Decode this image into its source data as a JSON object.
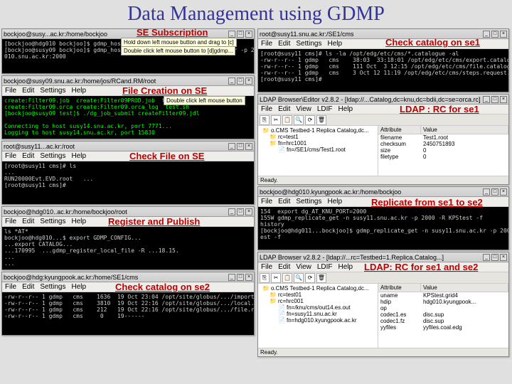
{
  "page_title": "Data Management using GDMP",
  "annotations": {
    "se_subscription": "SE Subscription",
    "file_creation": "File Creation on SE",
    "check_file": "Check File on SE",
    "register_publish": "Register and Publish",
    "check_catalog_se2": "Check catalog on se2",
    "check_catalog_se1": "Check catalog on se1",
    "ldap_rc_se1": "LDAP : RC for se1",
    "replicate": "Replicate from se1 to se2",
    "ldap_rc_both": "LDAP: RC for se1 and se2"
  },
  "tooltips": {
    "t1": "Hold down left mouse button and drag to [c]",
    "t2": "Double click left mouse button to [d]gdmp...",
    "t3": "Double click left mouse button"
  },
  "menus": {
    "term": [
      "File",
      "Edit",
      "Settings",
      "Help"
    ],
    "ldap": [
      "File",
      "Edit",
      "View",
      "LDIF",
      "Help"
    ]
  },
  "status_ready": "Ready.",
  "windows": {
    "w1": {
      "title": "bockjoo@susy...ac.kr:/home/bockjoo"
    },
    "w2": {
      "title": "bockjoo@susy09.snu.ac.kr:/home/jos/RCand.RM/root"
    },
    "w3": {
      "title": "root@susy11...ac.kr:/root"
    },
    "w4": {
      "title": "bockjoo@hdg010..ac.kr:/home/bockjoo/root"
    },
    "w5": {
      "title": "bockjoo@hdg:kyungpook.ac.kr:/home/SE1/cms"
    },
    "w6": {
      "title": "root@susy11.snu.ac.kr:/SE1/cms"
    },
    "w7": {
      "title": "LDAP Browser\\Editor v2.8.2 - [ldap://...Catalog,dc=knu,dc=bdii,dc=se=orca.rc]"
    },
    "w8": {
      "title": "bockjoo@hdg010.kyungpook.ac.kr:/home/bockjoo"
    },
    "w9": {
      "title": "LDAP Browser v2.8.2 - [ldap://...rc=Testbed=1.Replica.Catalog...]"
    }
  },
  "term_content": {
    "w1": "[bockjoo@hdg010 bockjoo]$ gdmp_host_subscribe...\n[bockjoo@susy09 bockjoo]$ gdmp_host_subscribe -r -S susy11.snu.ac.kr -p 2000 => hdg\n010.snu.ac.kr:2000",
    "w2": "create:Filter09.job  create:Filter09PROD.job  test.job\ncreate:Filter09.orca create:Filter09.orca_log  test.sh\n[bockjoo@susy09 test]$ ./dg_job_submit createFilter09.jdl\n\nConnecting to host susy14.snu.ac.kr, port 7771...\nLogging to host susy14.snu.ac.kr, port 15830",
    "w3": "[root@susy11 cms]# ls\n...\nRUN20000Evt.EVD.root   ...\n[root@susy11 cms]#",
    "w4": "ls *AT*\nbockjoo@hdg010...$ export GDMP_CONFIG...\n...export CATALOG...\n...170995  ...gdmp_register_local_file -R ...18.15.\n...\n...",
    "w5": "-rw-r--r-- 1 gdmp   cms    1636  19 Oct 23:04 /opt/site/globus/.../import_catalogue\n-rw-r--r-- 1 gdmp   cms    3810  19 Oct 22:16 /opt/site/globus/.../local.ste.catalogue\n-rw-r--r-- 1 gdmp   cms    212   19 Oct 22:16 /opt/site/globus/.../file.request.cque\n-rw-r--r-- 1 gdmp   cms     0    19------",
    "w6": "[root@susy11 cms]# ls -la /opt/edg/etc/cms/*.catalogue -al\n-rw-r--r-- 1 gdmp   cms    38:03  33:18:01 /opt/edg/etc/cms/export.catalogue\n-rw-r--r-- 1 gdmp   cms    111 Oct  3 12:15 /opt/edg/etc/cms/file.catalogue\n-rw-r--r-- 1 gdmp   cms    3 Oct 12 11:19 /opt/edg/etc/cms/steps.request.cata.cque\n[root@susy11 cms]#",
    "w8": "154  export dg_AT_KNU_PORT=2000\n155W gdmp_replicate_get -n susy11.snu.ac.kr -p 2000 -R KPStest -f\nhistory\n[bockjoo@hdg011...bockjoo]$ gdmp_replicate_get -n susy11.snu.ac.kr -p 2000 -R KPSt\nest -f"
  },
  "ldap1": {
    "root": "o.CMS Testbed-1 Replica Catalog,dc...",
    "items": [
      "rc=test1",
      "fn=hrc1001",
      "fn=/SE1/cms/Test1.root"
    ],
    "attrs": [
      [
        "filename",
        "Test1.root"
      ],
      [
        "checksum",
        "2450751893"
      ],
      [
        "size",
        "0"
      ],
      [
        "filetype",
        "0"
      ]
    ]
  },
  "ldap2": {
    "root": "o.CMS Testbed-1 Replica Catalog,dc...",
    "items": [
      "rc=test01",
      "rc=hrc001",
      "fn=/knu/cms/out14.es.out",
      "fn=susy11.snu.ac.kr",
      "fn=hdg010.kyungpook.ac.kr"
    ],
    "attrs": [
      [
        "uname",
        "KPStest.grid4"
      ],
      [
        "hdip",
        "hdg010.kyungpook..."
      ],
      [
        "op",
        ""
      ],
      [
        "codec1.es",
        "disc.sup"
      ],
      [
        "codec1.fz",
        "disc.sup"
      ],
      [
        "yyfiles",
        "yyfiles.coal.edg"
      ]
    ]
  },
  "col_headers": {
    "attr": "Attribute",
    "val": "Value"
  }
}
